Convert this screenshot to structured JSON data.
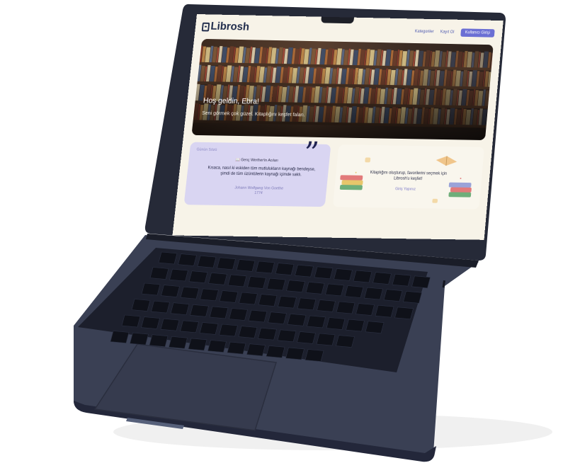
{
  "app": {
    "logo_text": "Librosh",
    "nav": {
      "categories": "Kategoriler",
      "register": "Kayıt Ol",
      "login": "Kullanıcı Girişi"
    }
  },
  "hero": {
    "title": "Hoş geldin, Ebra!",
    "subtitle": "Seni görmek çok güzel. Kitaplığını keşfet falan."
  },
  "quote_card": {
    "label": "Günün Sözü",
    "book": "Genç Werther'in Acıları",
    "text": "Kısaca, nasıl ki eskiden tüm mutlulukların kaynağı bendeyse, şimdi de tüm üzüntülerin kaynağı içimde saklı.",
    "author": "Johann Wolfgang Von Goethe",
    "year": "1774"
  },
  "login_card": {
    "text": "Kitaplığını oluşturup, favorilerini seçmek için Librosh'u keşfet!",
    "link": "Giriş Yapınız"
  },
  "colors": {
    "accent": "#6b6fd4",
    "quote_bg": "#d9d5f2",
    "page_bg": "#f7f3e8",
    "laptop": "#2a2f42"
  }
}
